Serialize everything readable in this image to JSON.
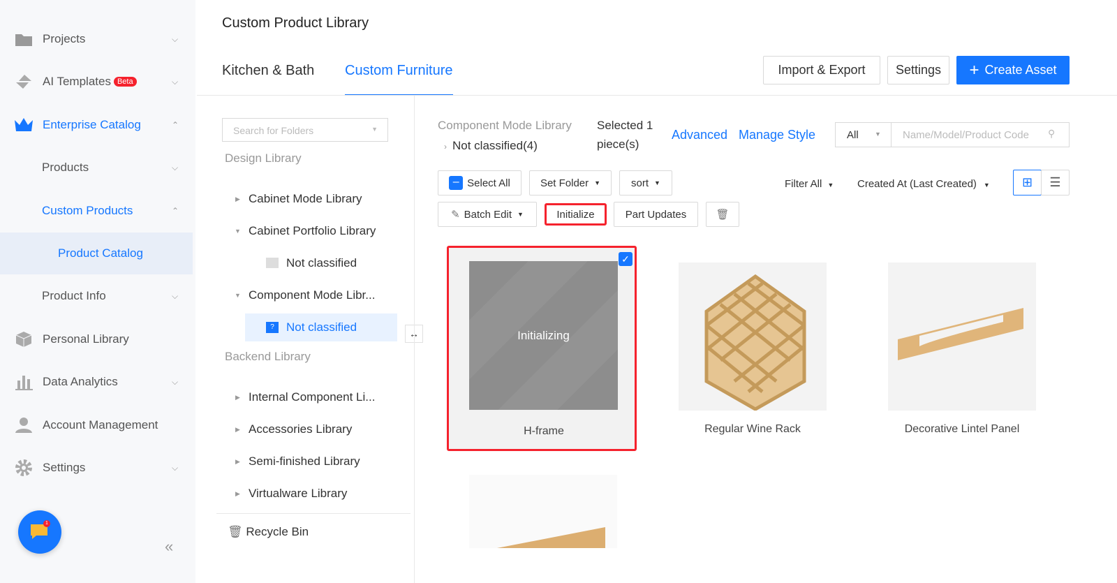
{
  "sidebar": {
    "items": [
      {
        "label": "Projects",
        "icon": "folder-icon"
      },
      {
        "label": "AI Templates",
        "badge": "Beta",
        "icon": "ai-template-icon"
      },
      {
        "label": "Enterprise Catalog",
        "icon": "crown-icon"
      },
      {
        "label": "Products"
      },
      {
        "label": "Custom Products"
      },
      {
        "label": "Product Catalog"
      },
      {
        "label": "Product Info"
      },
      {
        "label": "Personal Library",
        "icon": "cube-icon"
      },
      {
        "label": "Data Analytics",
        "icon": "bar-chart-icon"
      },
      {
        "label": "Account Management",
        "icon": "user-icon"
      },
      {
        "label": "Settings",
        "icon": "gear-icon"
      }
    ],
    "chat_badge": "1"
  },
  "header": {
    "title": "Custom Product Library",
    "tabs": [
      "Kitchen & Bath",
      "Custom Furniture"
    ],
    "active_tab": 1,
    "import_export": "Import & Export",
    "settings": "Settings",
    "create_asset": "Create Asset"
  },
  "folders": {
    "search_placeholder": "Search for Folders",
    "design_library": "Design Library",
    "tree": [
      "Cabinet Mode Library",
      "Cabinet Portfolio Library",
      "Not classified",
      "Component Mode Libr...",
      "Not classified"
    ],
    "backend_library": "Backend Library",
    "backend": [
      "Internal Component Li...",
      "Accessories Library",
      "Semi-finished Library",
      "Virtualware Library"
    ],
    "recycle_bin": "Recycle Bin"
  },
  "content": {
    "breadcrumb_root": "Component Mode Library",
    "breadcrumb_leaf": "Not classified(4)",
    "selected": "Selected 1",
    "selected_unit": "piece(s)",
    "advanced": "Advanced",
    "manage_style": "Manage Style",
    "scope": "All",
    "search_placeholder": "Name/Model/Product Code",
    "select_all": "Select All",
    "set_folder": "Set Folder",
    "sort": "sort",
    "filter_all": "Filter All",
    "order": "Created At (Last Created)",
    "batch_edit": "Batch Edit",
    "initialize": "Initialize",
    "part_updates": "Part Updates",
    "cards": [
      {
        "name": "H-frame",
        "status": "Initializing",
        "selected": true
      },
      {
        "name": "Regular Wine Rack"
      },
      {
        "name": "Decorative Lintel Panel"
      }
    ]
  }
}
